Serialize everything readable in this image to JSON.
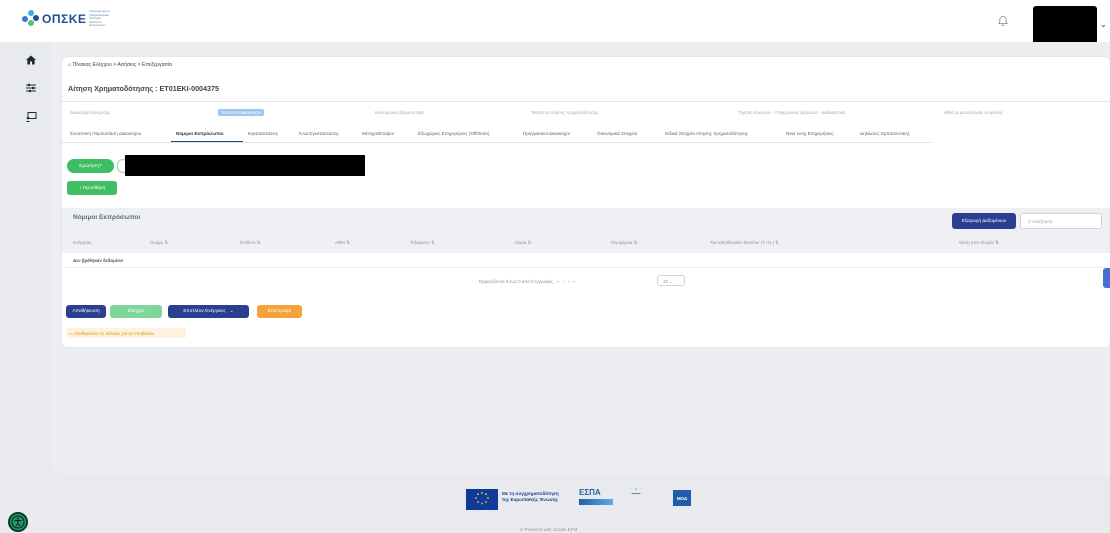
{
  "header": {
    "logo_text": "ΟΠΣΚΕ",
    "logo_subtitle": "Ολοκληρωμένο Πληροφοριακό Σύστημα Κρατικών Ενισχύσεων",
    "notification_icon": "bell-icon",
    "user_menu_icon": "chevron-down-icon"
  },
  "sidebar": {
    "items": [
      {
        "icon": "home-icon"
      },
      {
        "icon": "sliders-icon"
      },
      {
        "icon": "monitor-person-icon"
      }
    ]
  },
  "breadcrumb": "Πίνακας Ελέγχου > Αιτήσεις > Επεξεργασία",
  "page_title": "Αίτηση Χρηματοδότησης : ΕΤ01ΕΚΙ-0004375",
  "steps": [
    "Δικαιούχοι Ενίσχυσης",
    "Ταυτότητα Δικαιούχου",
    "Ηλεκτρονική Δήλωση ΜμΕ",
    "Ταυτότητα Αίτησης Χρηματοδότησης",
    "Τήρηση Κανόνων - Υποχρεώσεις Δηλώσεις - Διαδικαστικά",
    "Ηθική & Δεοντολογία, Ασφάλεια"
  ],
  "tabs": [
    "Συνοπτική Παρουσίαση Δικαιούχου",
    "Νόμιμοι Εκπρόσωποι",
    "Εγκαταστάσεις",
    "ΚΑΔ Εγκατάστασης",
    "Μέτοχοι/Εταίροι",
    "Εξωχώριες Επιχειρήσεις (Offshore)",
    "Πραγματικοί Δικαιούχοι",
    "Οικονομικά Στοιχεία",
    "Ειδικά Στοιχεία Αίτησης Χρηματοδότησης",
    "Next ενσχ Επιχειρήσεις",
    "Δηλώσεις Εμπιστευτικής"
  ],
  "actions": {
    "select_label": "Ερώτηση?",
    "add_label": "+ Προσθήκη",
    "export_label": "Εξαγωγή Δεδομένων",
    "search_placeholder": "Αναζήτηση"
  },
  "table": {
    "title": "Νόμιμοι Εκπρόσωποι",
    "columns": [
      "Ενέργειες",
      "Όνομα",
      "Επίθετο",
      "ΑΦΜ",
      "Τηλέφωνο",
      "Χώρα",
      "Περιφέρεια",
      "Tax Identification Number (T.I.N.)",
      "Θέση στον Φορέα"
    ],
    "empty_text": "Δεν βρέθηκαν δεδομένα",
    "pagination_text": "Εμφανίζονται 0 έως 0 από 0 εγγραφές",
    "page_size": "10"
  },
  "form_actions": {
    "save": "Αποθήκευση",
    "check": "Έλεγχος",
    "more": "Επιπλέον Ενέργειες",
    "back": "Επιστροφή"
  },
  "warning": "Αποθηκεύστε τις αλλαγές για να Υποβάλετε.",
  "footer": {
    "eu_text_1": "Με τη συγχρηματοδότηση",
    "eu_text_2": "της Ευρωπαϊκής Ένωσης",
    "espa_text": "ΕΣΠΑ",
    "moda_text": "ΜΟΔ",
    "powered_by": "© Powered with Scalite EPM"
  },
  "colors": {
    "primary": "#2a3f8f",
    "success": "#3ebd62",
    "light_success": "#7fd69a",
    "warning": "#f4a23b",
    "info": "#4a6fd1"
  }
}
